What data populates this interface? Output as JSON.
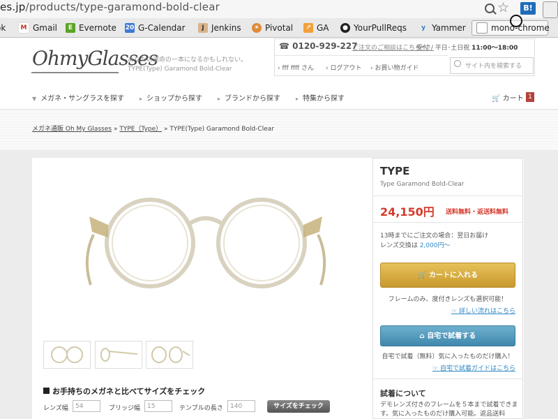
{
  "browser": {
    "url_prefix": "es.jp",
    "url_path": "/products/type-garamond-bold-clear",
    "hatena_label": "B!",
    "bookmarks": [
      {
        "label": "ok",
        "icon": "bookmark-icon"
      },
      {
        "label": "Gmail",
        "icon": "gmail-icon"
      },
      {
        "label": "Evernote",
        "icon": "evernote-icon"
      },
      {
        "label": "G-Calendar",
        "icon": "calendar-icon",
        "badge": "20"
      },
      {
        "label": "Jenkins",
        "icon": "jenkins-icon"
      },
      {
        "label": "Pivotal",
        "icon": "pivotal-icon"
      },
      {
        "label": "GA",
        "icon": "analytics-icon"
      },
      {
        "label": "YourPullReqs",
        "icon": "github-icon"
      },
      {
        "label": "Yammer",
        "icon": "yammer-icon"
      },
      {
        "label": "mono-chrome",
        "icon": "page-icon"
      }
    ]
  },
  "header": {
    "logo": "OhmyGlasses",
    "tagline_1": "あなたの運命の一本になるかもしれない。",
    "tagline_2": "TYPE(Type) Garamond Bold-Clear",
    "phone": "0120-929-227",
    "phone_link": "ご注文のご相談はこちらへ！",
    "hours_label": "受付 / 平日･土日祝",
    "hours_value": "11:00～18:00",
    "user_name": "fff ffff さん",
    "logout": "ログアウト",
    "shopping_guide": "お買い物ガイド",
    "search_placeholder": "サイト内を検索する"
  },
  "nav": {
    "items": [
      "メガネ・サングラスを探す",
      "ショップから探す",
      "ブランドから探す",
      "特集から探す"
    ],
    "cart_label": "カート",
    "cart_count": "1"
  },
  "breadcrumb": {
    "home": "メガネ通販 Oh My Glasses",
    "sep": "»",
    "brand": "TYPE（Type）",
    "current": "TYPE(Type) Garamond Bold-Clear"
  },
  "product": {
    "brand": "TYPE",
    "model": "Type Garamond Bold-Clear",
    "price": "24,150円",
    "shipping": "送料無料・返送料無料",
    "delivery": "13時までにご注文の場合：翌日お届け",
    "lens_label": "レンズ交換は",
    "lens_price": "2,000円〜",
    "cart_button": "カートに入れる",
    "cart_note": "フレームのみ、度付きレンズも選択可能！",
    "cart_more": "詳しい流れはこちら",
    "try_button": "自宅で試着する",
    "try_note": "自宅で試着（無料）気に入ったものだけ購入！",
    "try_more": "自宅で試着ガイドはこちら",
    "tryon_title": "試着について",
    "tryon_desc": "デモレンズ付きのフレームを５本まで試着できます。気に入ったものだけ購入可能。返品送料"
  },
  "size_check": {
    "title": "お手持ちのメガネと比べてサイズをチェック",
    "lens_label": "レンズ幅",
    "lens_value": "54",
    "bridge_label": "ブリッジ幅",
    "bridge_value": "15",
    "temple_label": "テンプルの長さ",
    "temple_value": "140",
    "button": "サイズをチェック"
  },
  "colors": {
    "price": "#d43a2a",
    "cart_button": "#d4ab3f",
    "try_button": "#5a9fc1",
    "link": "#2f87c4",
    "cart_badge": "#b4423c"
  }
}
